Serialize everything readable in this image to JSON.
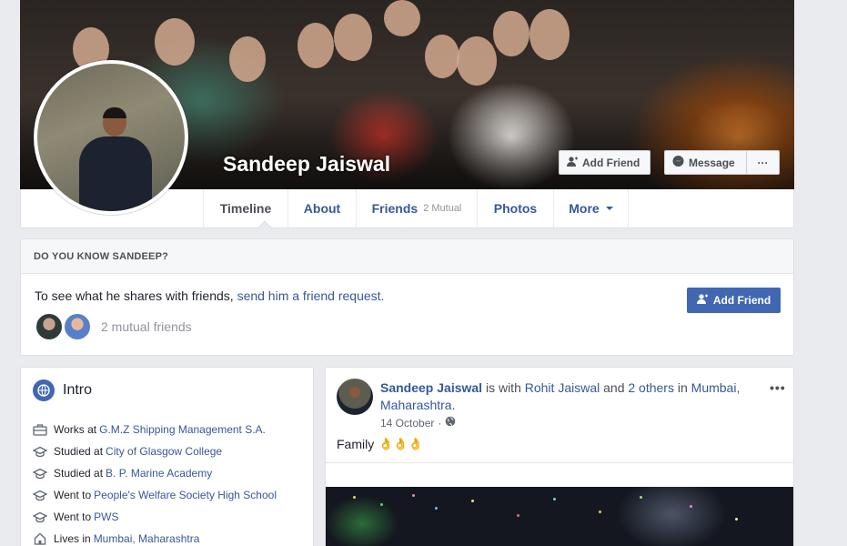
{
  "profile": {
    "name": "Sandeep Jaiswal",
    "add_friend_label": "Add Friend",
    "message_label": "Message",
    "more_label": "···"
  },
  "tabs": [
    {
      "label": "Timeline"
    },
    {
      "label": "About"
    },
    {
      "label": "Friends",
      "sub": "2 Mutual"
    },
    {
      "label": "Photos"
    },
    {
      "label": "More"
    }
  ],
  "know_box": {
    "heading": "DO YOU KNOW SANDEEP?",
    "text_prefix": "To see what he shares with friends, ",
    "link_text": "send him a friend request.",
    "button_label": "Add Friend",
    "mutual_text": "2 mutual friends"
  },
  "intro": {
    "title": "Intro",
    "items": [
      {
        "icon": "work-icon",
        "prefix": "Works at",
        "link": "G.M.Z Shipping Management S.A."
      },
      {
        "icon": "education-icon",
        "prefix": "Studied at",
        "link": "City of Glasgow College"
      },
      {
        "icon": "education-icon",
        "prefix": "Studied at",
        "link": "B. P. Marine Academy"
      },
      {
        "icon": "education-icon",
        "prefix": "Went to",
        "link": "People's Welfare Society High School"
      },
      {
        "icon": "education-icon",
        "prefix": "Went to",
        "link": "PWS"
      },
      {
        "icon": "home-icon",
        "prefix": "Lives in",
        "link": "Mumbai, Maharashtra"
      }
    ]
  },
  "post": {
    "author": "Sandeep Jaiswal",
    "with_text": " is with ",
    "tagged": "Rohit Jaiswal",
    "and_text": " and ",
    "others": "2 others",
    "in_text": " in ",
    "place": "Mumbai, Maharashtra",
    "period": ".",
    "date": "14 October",
    "dot": "·",
    "text": "Family",
    "emoji": "👌👌👌",
    "menu": "•••"
  },
  "colors": {
    "link": "#365899",
    "primary_button": "#4267b2",
    "page_bg": "#e9ebee"
  }
}
